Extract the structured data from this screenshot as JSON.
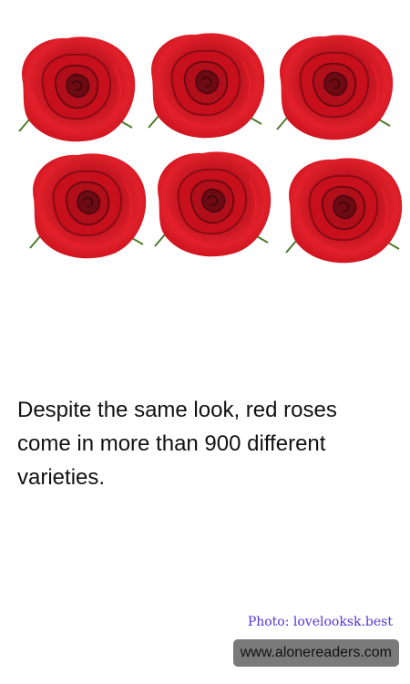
{
  "fact_text": "Despite the same look, red roses come in more than 900 different varieties.",
  "photo_credit": "Photo: lovelooksk.best",
  "website": "www.alonereaders.com",
  "image": {
    "subject": "six red roses arranged in two rows of three",
    "colors": {
      "rose_light": "#e8202a",
      "rose_mid": "#c8101c",
      "rose_dark": "#6e0a12",
      "leaf": "#4f7a2a"
    }
  }
}
